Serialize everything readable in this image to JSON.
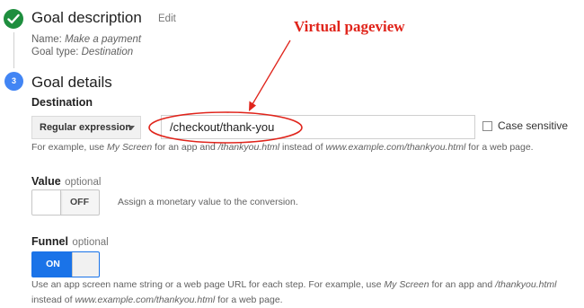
{
  "step1": {
    "title": "Goal description",
    "edit_label": "Edit",
    "name_prefix": "Name: ",
    "name_value": "Make a payment",
    "type_prefix": "Goal type: ",
    "type_value": "Destination"
  },
  "step3": {
    "number": "3",
    "title": "Goal details"
  },
  "destination": {
    "label": "Destination",
    "match_type": "Regular expression",
    "value": "/checkout/thank-you",
    "case_sensitive_label": "Case sensitive",
    "case_sensitive_checked": false,
    "help": {
      "p1": "For example, use ",
      "i1": "My Screen",
      "p2": " for an app and ",
      "i2": "/thankyou.html",
      "p3": " instead of ",
      "i3": "www.example.com/thankyou.html",
      "p4": " for a web page."
    }
  },
  "value_section": {
    "label": "Value",
    "optional": "optional",
    "toggle_state": "OFF",
    "description": "Assign a monetary value to the conversion."
  },
  "funnel_section": {
    "label": "Funnel",
    "optional": "optional",
    "toggle_state": "ON",
    "help": {
      "p1": "Use an app screen name string or a web page URL for each step. For example, use ",
      "i1": "My Screen",
      "p2": " for an app and ",
      "i2": "/thankyou.html",
      "p3": " instead of ",
      "i3": "www.example.com/thankyou.html",
      "p4": " for a web page."
    }
  },
  "annotation": {
    "text": "Virtual pageview",
    "color": "#e0241b"
  },
  "colors": {
    "success_green": "#1e8e3e",
    "step_blue": "#4285f4",
    "toggle_on_blue": "#1a73e8"
  }
}
